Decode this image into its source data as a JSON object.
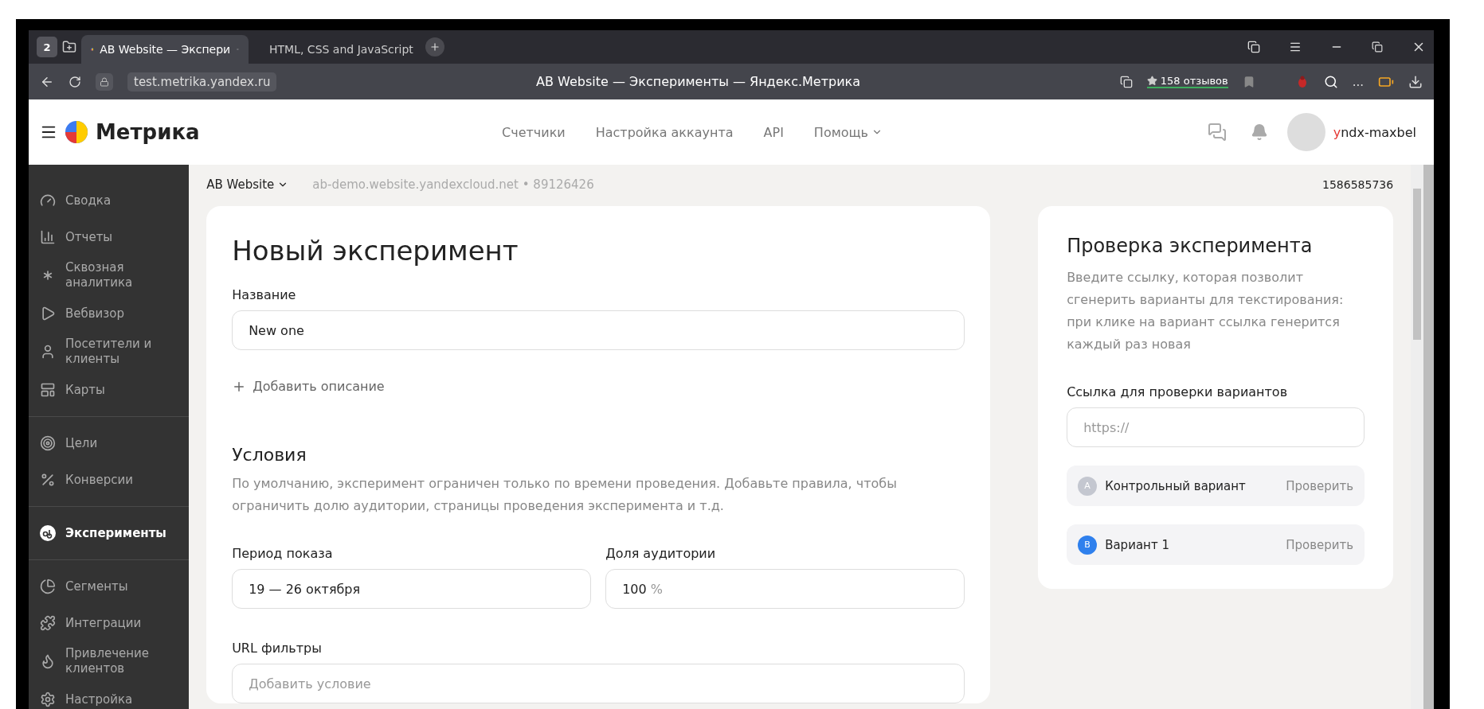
{
  "browser": {
    "tab_count": "2",
    "tabs": [
      {
        "title": "AB Website — Экспери",
        "selected": true,
        "kind": "metrika"
      },
      {
        "title": "HTML, CSS and JavaScript",
        "selected": false,
        "kind": "chart"
      }
    ],
    "address": "test.metrika.yandex.ru",
    "page_title": "AB Website — Эксперименты — Яндекс.Метрика",
    "reviews": "158 отзывов",
    "more": "..."
  },
  "header": {
    "logo": "Метрика",
    "nav": [
      {
        "label": "Счетчики",
        "dropdown": false
      },
      {
        "label": "Настройка аккаунта",
        "dropdown": false
      },
      {
        "label": "API",
        "dropdown": false
      },
      {
        "label": "Помощь",
        "dropdown": true
      }
    ],
    "user": {
      "first": "y",
      "rest": "ndx-maxbel"
    }
  },
  "sidebar": {
    "groups": [
      [
        {
          "label": "Сводка",
          "selected": false
        },
        {
          "label": "Отчеты",
          "selected": false
        },
        {
          "label": "Сквозная аналитика",
          "selected": false
        },
        {
          "label": "Вебвизор",
          "selected": false
        },
        {
          "label": "Посетители и клиенты",
          "selected": false
        },
        {
          "label": "Карты",
          "selected": false
        }
      ],
      [
        {
          "label": "Цели",
          "selected": false
        },
        {
          "label": "Конверсии",
          "selected": false
        }
      ],
      [
        {
          "label": "Эксперименты",
          "selected": true
        }
      ],
      [
        {
          "label": "Сегменты",
          "selected": false
        },
        {
          "label": "Интеграции",
          "selected": false
        },
        {
          "label": "Привлечение клиентов",
          "selected": false
        },
        {
          "label": "Настройка",
          "selected": false
        }
      ]
    ]
  },
  "counter": {
    "name": "AB Website",
    "site": "ab-demo.website.yandexcloud.net • 89126426",
    "id": "1586585736"
  },
  "form": {
    "title": "Новый эксперимент",
    "name_label": "Название",
    "name_value": "New one",
    "add_description": "Добавить описание",
    "conditions_title": "Условия",
    "conditions_text": "По умолчанию, эксперимент ограничен только по времени проведения. Добавьте правила, чтобы ограничить долю аудитории, страницы проведения эксперимента и т.д.",
    "period_label": "Период показа",
    "period_value": "19 — 26 октября",
    "share_label": "Доля аудитории",
    "share_value": "100",
    "share_unit": "%",
    "url_label": "URL фильтры",
    "url_placeholder": "Добавить условие"
  },
  "check": {
    "title": "Проверка эксперимента",
    "text": "Введите ссылку, которая позволит сгенерить варианты для текстирования: при клике на вариант ссылка генерится каждый раз новая",
    "link_label": "Ссылка для проверки вариантов",
    "link_placeholder": "https://",
    "variants": [
      {
        "letter": "A",
        "name": "Контрольный вариант",
        "action": "Проверить",
        "color": "#c4c7d0"
      },
      {
        "letter": "B",
        "name": "Вариант 1",
        "action": "Проверить",
        "color": "#2f80ed"
      }
    ]
  }
}
